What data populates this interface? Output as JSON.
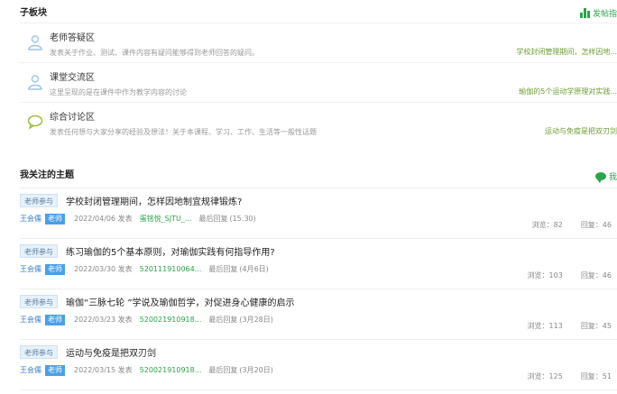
{
  "subboards": {
    "title": "子板块",
    "action_label": "发帖指",
    "items": [
      {
        "name": "老师答疑区",
        "desc": "发表关于作业、测试、课件内容有疑问能够得到老师回答的疑问。",
        "latest": "学校封闭管理期间，怎样因地..."
      },
      {
        "name": "课堂交流区",
        "desc": "这里呈现的是在课件中作为教学内容的讨论",
        "latest": "瑜伽的5个运动学原理对实践..."
      },
      {
        "name": "综合讨论区",
        "desc": "发表任何想与大家分享的经验及想法！关于本课程、学习、工作、生活等一般性话题",
        "latest": "运动与免疫是把双刃剑"
      }
    ]
  },
  "topics": {
    "title": "我关注的主题",
    "action_label": "我",
    "items": [
      {
        "tag": "老师参与",
        "title": "学校封闭管理期间，怎样因地制宜规律锻炼?",
        "author": "王会儒",
        "badge": "老师",
        "date": "2022/04/06 发表",
        "last_user": "蛋铭悦_SJTU_...",
        "last_label": "最后回复",
        "last_date": "(15:30)",
        "views": "浏览：82",
        "replies": "回复：46"
      },
      {
        "tag": "老师参与",
        "title": "练习瑜伽的5个基本原则，对瑜伽实践有何指导作用?",
        "author": "王会儒",
        "badge": "老师",
        "date": "2022/03/30 发表",
        "last_user": "520111910064...",
        "last_label": "最后回复",
        "last_date": "(4月6日)",
        "views": "浏览：103",
        "replies": "回复：46"
      },
      {
        "tag": "老师参与",
        "title": "瑜伽“三脉七轮 ”学说及瑜伽哲学，对促进身心健康的启示",
        "author": "王会儒",
        "badge": "老师",
        "date": "2022/03/23 发表",
        "last_user": "520021910918...",
        "last_label": "最后回复",
        "last_date": "(3月28日)",
        "views": "浏览：113",
        "replies": "回复：45"
      },
      {
        "tag": "老师参与",
        "title": "运动与免疫是把双刃剑",
        "author": "王会儒",
        "badge": "老师",
        "date": "2022/03/15 发表",
        "last_user": "520021910918...",
        "last_label": "最后回复",
        "last_date": "(3月20日)",
        "views": "浏览：125",
        "replies": "回复：51"
      }
    ]
  },
  "colors": {
    "accent": "#2aa54a",
    "link_blue": "#3a7fc8",
    "latest_green": "#6f9a35",
    "badge_blue": "#4a9fe8"
  }
}
